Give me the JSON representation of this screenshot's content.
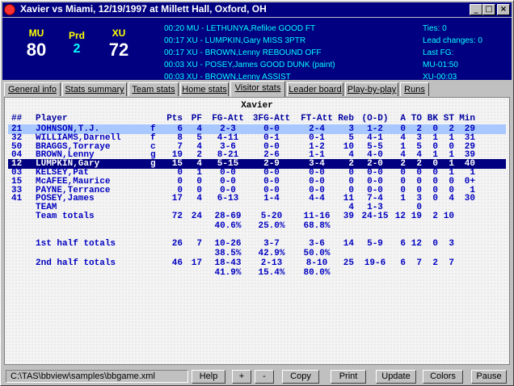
{
  "window": {
    "title": "Xavier vs Miami, 12/19/1997 at Millett Hall, Oxford, OH",
    "btn_min": "_",
    "btn_max": "□",
    "btn_close": "×"
  },
  "scoreboard": {
    "home_abbr": "MU",
    "home_score": "80",
    "period_label": "Prd",
    "period": "2",
    "away_abbr": "XU",
    "away_score": "72",
    "play_by_play": [
      "00:20 MU - LETHUNYA,Refiloe GOOD FT",
      "00:17 XU - LUMPKIN,Gary MISS 3PTR",
      "00:17 XU - BROWN,Lenny REBOUND OFF",
      "00:03 XU - POSEY,James GOOD DUNK (paint)",
      "00:03 XU - BROWN,Lenny ASSIST"
    ],
    "game_stats": [
      "Ties: 0",
      "Lead changes: 0",
      "Last FG:",
      "MU-01:50",
      "XU-00:03"
    ]
  },
  "tabs": [
    "General info",
    "Stats summary",
    "Team stats",
    "Home stats",
    "Visitor stats",
    "Leader board",
    "Play-by-play",
    "Runs"
  ],
  "table": {
    "team_name": "Xavier",
    "headers": [
      "##",
      "Player",
      "Pts",
      "PF",
      "FG-Att",
      "3FG-Att",
      "FT-Att",
      "Reb",
      "(O-D)",
      "A",
      "TO",
      "BK",
      "ST",
      "Min"
    ],
    "players": [
      [
        "21",
        "JOHNSON,T.J.",
        "f",
        "6",
        "4",
        "2-3",
        "0-0",
        "2-4",
        "3",
        "1-2",
        "0",
        "2",
        "0",
        "2",
        "29"
      ],
      [
        "32",
        "WILLIAMS,Darnell",
        "f",
        "8",
        "5",
        "4-11",
        "0-1",
        "0-1",
        "5",
        "4-1",
        "4",
        "3",
        "1",
        "1",
        "31"
      ],
      [
        "50",
        "BRAGGS,Torraye",
        "c",
        "7",
        "4",
        "3-6",
        "0-0",
        "1-2",
        "10",
        "5-5",
        "1",
        "5",
        "0",
        "0",
        "29"
      ],
      [
        "04",
        "BROWN,Lenny",
        "g",
        "19",
        "2",
        "8-21",
        "2-6",
        "1-1",
        "4",
        "4-0",
        "4",
        "4",
        "1",
        "1",
        "39"
      ],
      [
        "12",
        "LUMPKIN,Gary",
        "g",
        "15",
        "4",
        "5-15",
        "2-9",
        "3-4",
        "2",
        "2-0",
        "2",
        "2",
        "0",
        "1",
        "40"
      ],
      [
        "03",
        "KELSEY,Pat",
        "",
        "0",
        "1",
        "0-0",
        "0-0",
        "0-0",
        "0",
        "0-0",
        "0",
        "0",
        "0",
        "1",
        "1"
      ],
      [
        "15",
        "McAFEE,Maurice",
        "",
        "0",
        "0",
        "0-0",
        "0-0",
        "0-0",
        "0",
        "0-0",
        "0",
        "0",
        "0",
        "0",
        "0+"
      ],
      [
        "33",
        "PAYNE,Terrance",
        "",
        "0",
        "0",
        "0-0",
        "0-0",
        "0-0",
        "0",
        "0-0",
        "0",
        "0",
        "0",
        "0",
        "1"
      ],
      [
        "41",
        "POSEY,James",
        "",
        "17",
        "4",
        "6-13",
        "1-4",
        "4-4",
        "11",
        "7-4",
        "1",
        "3",
        "0",
        "4",
        "30"
      ]
    ],
    "team_row": {
      "label": "TEAM",
      "reb": "4",
      "od": "1-3",
      "to": "0"
    },
    "totals": [
      {
        "label": "Team totals",
        "pts": "72",
        "pf": "24",
        "fg": "28-69",
        "fg3": "5-20",
        "ft": "11-16",
        "reb": "39",
        "od": "24-15",
        "a": "12",
        "to": "19",
        "bk": "2",
        "st": "10",
        "fg_pct": "40.6%",
        "fg3_pct": "25.0%",
        "ft_pct": "68.8%"
      },
      {
        "label": "1st half totals",
        "pts": "26",
        "pf": "7",
        "fg": "10-26",
        "fg3": "3-7",
        "ft": "3-6",
        "reb": "14",
        "od": "5-9",
        "a": "6",
        "to": "12",
        "bk": "0",
        "st": "3",
        "fg_pct": "38.5%",
        "fg3_pct": "42.9%",
        "ft_pct": "50.0%"
      },
      {
        "label": "2nd half totals",
        "pts": "46",
        "pf": "17",
        "fg": "18-43",
        "fg3": "2-13",
        "ft": "8-10",
        "reb": "25",
        "od": "19-6",
        "a": "6",
        "to": "7",
        "bk": "2",
        "st": "7",
        "fg_pct": "41.9%",
        "fg3_pct": "15.4%",
        "ft_pct": "80.0%"
      }
    ]
  },
  "statusbar": {
    "path": "C:\\TAS\\bbview\\samples\\bbgame.xml",
    "buttons": [
      "Help",
      "+",
      "-",
      "Copy",
      "Print",
      "Update",
      "Colors",
      "Pause"
    ]
  }
}
